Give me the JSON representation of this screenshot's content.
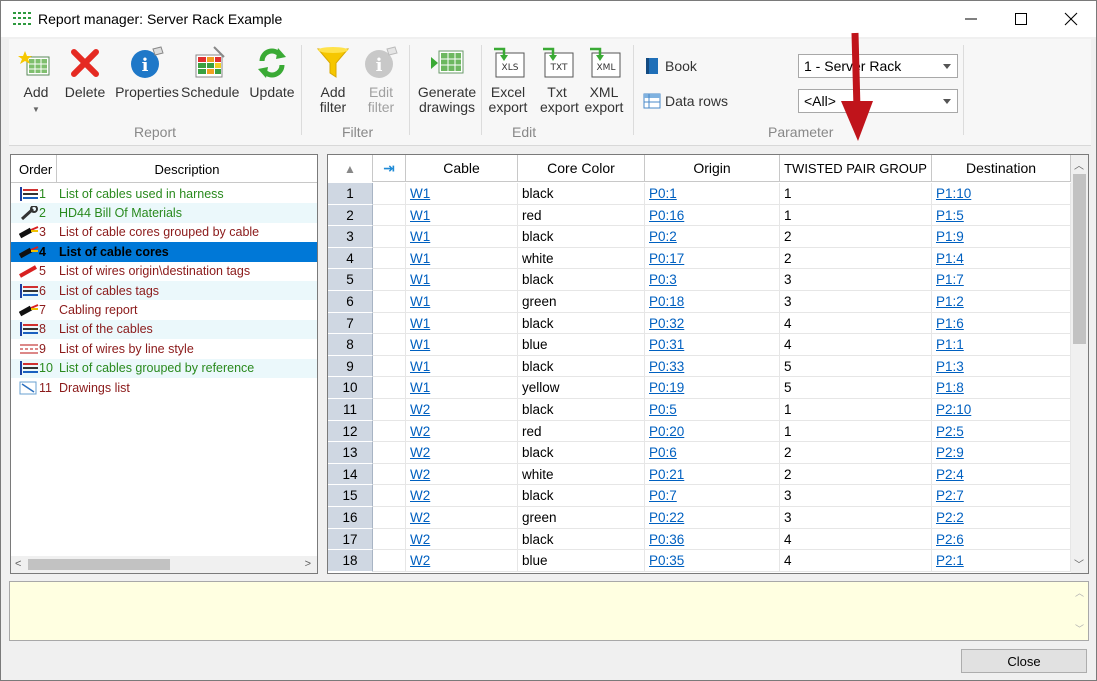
{
  "window": {
    "title": "Report manager: Server Rack Example"
  },
  "ribbon": {
    "add": "Add",
    "delete": "Delete",
    "properties": "Properties",
    "schedule": "Schedule",
    "update": "Update",
    "add_filter": "Add filter",
    "edit_filter": "Edit filter",
    "generate_drawings": "Generate drawings",
    "excel_export": "Excel export",
    "txt_export": "Txt export",
    "xml_export": "XML export",
    "book": "Book",
    "data_rows": "Data rows",
    "group_report": "Report",
    "group_filter": "Filter",
    "group_edit": "Edit",
    "group_parameter": "Parameter",
    "combo_1": "1 - Server Rack",
    "combo_2": "<All>"
  },
  "reports": {
    "header_order": "Order",
    "header_description": "Description",
    "items": [
      {
        "num": "1",
        "label": "List of cables used in harness",
        "color": "#2a8a1e"
      },
      {
        "num": "2",
        "label": "HD44 Bill Of Materials",
        "color": "#2a8a1e"
      },
      {
        "num": "3",
        "label": "List of cable cores grouped by cable",
        "color": "#8b1a1a"
      },
      {
        "num": "4",
        "label": "List of cable cores",
        "color": "#000000"
      },
      {
        "num": "5",
        "label": "List of wires origin\\destination tags",
        "color": "#8b1a1a"
      },
      {
        "num": "6",
        "label": "List of cables tags",
        "color": "#8b1a1a"
      },
      {
        "num": "7",
        "label": "Cabling report",
        "color": "#8b1a1a"
      },
      {
        "num": "8",
        "label": "List of the cables",
        "color": "#8b1a1a"
      },
      {
        "num": "9",
        "label": "List of wires by line style",
        "color": "#8b1a1a"
      },
      {
        "num": "10",
        "label": "List of cables grouped by reference",
        "color": "#2a8a1e"
      },
      {
        "num": "11",
        "label": "Drawings list",
        "color": "#8b1a1a"
      }
    ]
  },
  "grid": {
    "headers": {
      "cable": "Cable",
      "core_color": "Core Color",
      "origin": "Origin",
      "twisted": "TWISTED PAIR GROUP",
      "destination": "Destination"
    },
    "rows": [
      [
        "1",
        "W1",
        "black",
        "P0:1",
        "1",
        "P1:10"
      ],
      [
        "2",
        "W1",
        "red",
        "P0:16",
        "1",
        "P1:5"
      ],
      [
        "3",
        "W1",
        "black",
        "P0:2",
        "2",
        "P1:9"
      ],
      [
        "4",
        "W1",
        "white",
        "P0:17",
        "2",
        "P1:4"
      ],
      [
        "5",
        "W1",
        "black",
        "P0:3",
        "3",
        "P1:7"
      ],
      [
        "6",
        "W1",
        "green",
        "P0:18",
        "3",
        "P1:2"
      ],
      [
        "7",
        "W1",
        "black",
        "P0:32",
        "4",
        "P1:6"
      ],
      [
        "8",
        "W1",
        "blue",
        "P0:31",
        "4",
        "P1:1"
      ],
      [
        "9",
        "W1",
        "black",
        "P0:33",
        "5",
        "P1:3"
      ],
      [
        "10",
        "W1",
        "yellow",
        "P0:19",
        "5",
        "P1:8"
      ],
      [
        "11",
        "W2",
        "black",
        "P0:5",
        "1",
        "P2:10"
      ],
      [
        "12",
        "W2",
        "red",
        "P0:20",
        "1",
        "P2:5"
      ],
      [
        "13",
        "W2",
        "black",
        "P0:6",
        "2",
        "P2:9"
      ],
      [
        "14",
        "W2",
        "white",
        "P0:21",
        "2",
        "P2:4"
      ],
      [
        "15",
        "W2",
        "black",
        "P0:7",
        "3",
        "P2:7"
      ],
      [
        "16",
        "W2",
        "green",
        "P0:22",
        "3",
        "P2:2"
      ],
      [
        "17",
        "W2",
        "black",
        "P0:36",
        "4",
        "P2:6"
      ],
      [
        "18",
        "W2",
        "blue",
        "P0:35",
        "4",
        "P2:1"
      ]
    ]
  },
  "footer": {
    "close": "Close"
  },
  "colors": {
    "selection": "#0078d7",
    "link": "#0060c0",
    "notes_bg": "#ffffe1",
    "arrow": "#c0141b"
  }
}
